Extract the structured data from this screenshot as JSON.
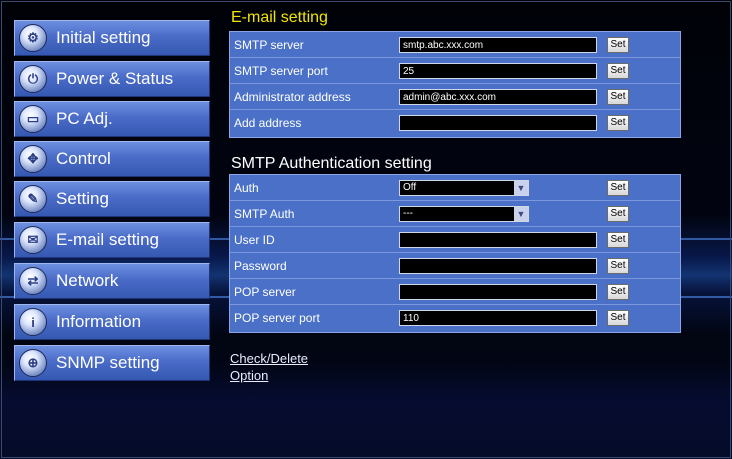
{
  "sidebar": {
    "items": [
      {
        "label": "Initial setting",
        "icon": "gear-icon"
      },
      {
        "label": "Power & Status",
        "icon": "power-icon"
      },
      {
        "label": "PC Adj.",
        "icon": "monitor-icon"
      },
      {
        "label": "Control",
        "icon": "control-icon"
      },
      {
        "label": "Setting",
        "icon": "wrench-icon"
      },
      {
        "label": "E-mail setting",
        "icon": "envelope-icon"
      },
      {
        "label": "Network",
        "icon": "network-icon"
      },
      {
        "label": "Information",
        "icon": "info-icon"
      },
      {
        "label": "SNMP setting",
        "icon": "snmp-icon"
      }
    ]
  },
  "email_setting": {
    "title": "E-mail setting",
    "title_color": "#f2e500",
    "rows": [
      {
        "label": "SMTP server",
        "value": "smtp.abc.xxx.com",
        "button": "Set"
      },
      {
        "label": "SMTP server port",
        "value": "25",
        "button": "Set"
      },
      {
        "label": "Administrator address",
        "value": "admin@abc.xxx.com",
        "button": "Set"
      },
      {
        "label": "Add address",
        "value": "",
        "button": "Set"
      }
    ]
  },
  "smtp_auth_setting": {
    "title": "SMTP Authentication setting",
    "rows": [
      {
        "label": "Auth",
        "type": "select",
        "value": "Off",
        "button": "Set"
      },
      {
        "label": "SMTP Auth",
        "type": "select",
        "value": "---",
        "button": "Set"
      },
      {
        "label": "User ID",
        "type": "input",
        "value": "",
        "button": "Set"
      },
      {
        "label": "Password",
        "type": "input",
        "value": "",
        "button": "Set"
      },
      {
        "label": "POP server",
        "type": "input",
        "value": "",
        "button": "Set"
      },
      {
        "label": "POP server port",
        "type": "input",
        "value": "110",
        "button": "Set"
      }
    ]
  },
  "links": {
    "check_delete": "Check/Delete",
    "option": "Option"
  }
}
